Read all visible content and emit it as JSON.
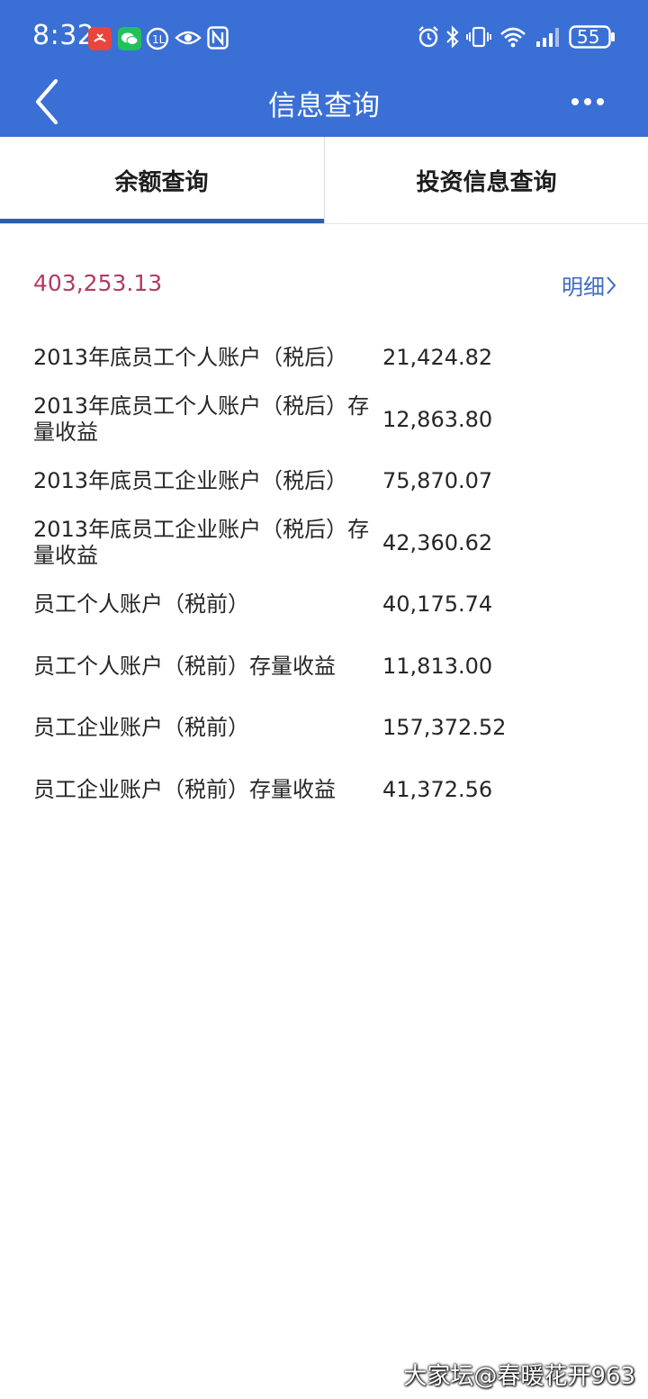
{
  "status_bar": {
    "time": "8:32",
    "battery": "55",
    "icons": [
      "missed-call-icon",
      "wechat-icon",
      "app-notification-icon",
      "eye-icon",
      "nfc-icon",
      "alarm-icon",
      "bluetooth-icon",
      "vibrate-icon",
      "wifi-icon",
      "signal-icon",
      "battery-icon"
    ]
  },
  "header": {
    "title": "信息查询",
    "back_icon": "back-arrow-icon",
    "more_icon": "more-dots-icon"
  },
  "tabs": [
    {
      "label": "余额查询",
      "active": true
    },
    {
      "label": "投资信息查询",
      "active": false
    }
  ],
  "summary": {
    "total": "403,253.13",
    "detail_label": "明细"
  },
  "items": [
    {
      "label": "2013年底员工个人账户（税后）",
      "value": "21,424.82"
    },
    {
      "label": "2013年底员工个人账户（税后）存量收益",
      "value": "12,863.80"
    },
    {
      "label": "2013年底员工企业账户（税后）",
      "value": "75,870.07"
    },
    {
      "label": "2013年底员工企业账户（税后）存量收益",
      "value": "42,360.62"
    },
    {
      "label": "员工个人账户（税前）",
      "value": "40,175.74"
    },
    {
      "label": "员工个人账户（税前）存量收益",
      "value": "11,813.00"
    },
    {
      "label": "员工企业账户（税前）",
      "value": "157,372.52"
    },
    {
      "label": "员工企业账户（税前）存量收益",
      "value": "41,372.56"
    }
  ],
  "watermark": "大家坛@春暖花开963",
  "colors": {
    "header_bg": "#3a6fd6",
    "total_text": "#b23a63",
    "link_text": "#3c6bbf",
    "tab_indicator": "#2f5ea8"
  }
}
